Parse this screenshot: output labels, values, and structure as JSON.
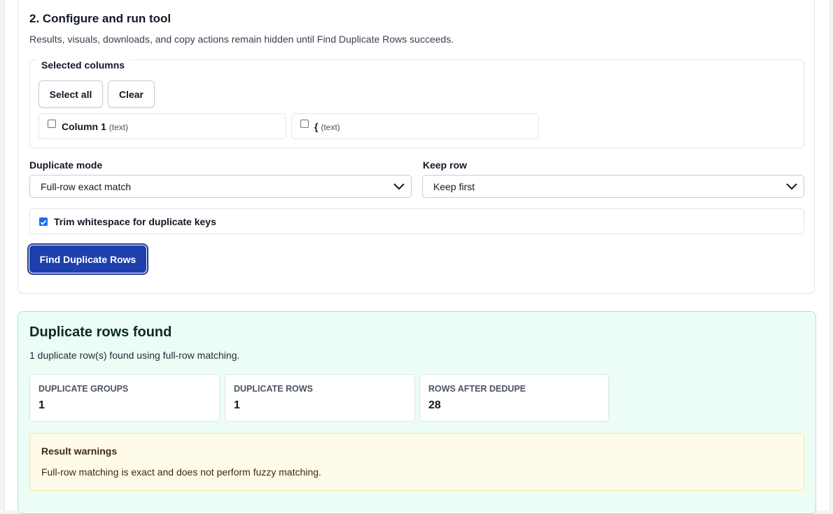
{
  "config": {
    "title": "2. Configure and run tool",
    "description": "Results, visuals, downloads, and copy actions remain hidden until Find Duplicate Rows succeeds.",
    "selected_columns": {
      "legend": "Selected columns",
      "select_all_label": "Select all",
      "clear_label": "Clear",
      "columns": [
        {
          "name": "Column 1",
          "type": "(text)",
          "checked": false
        },
        {
          "name": "{",
          "type": "(text)",
          "checked": false
        }
      ]
    },
    "duplicate_mode": {
      "label": "Duplicate mode",
      "value": "Full-row exact match"
    },
    "keep_row": {
      "label": "Keep row",
      "value": "Keep first"
    },
    "trim_whitespace": {
      "label": "Trim whitespace for duplicate keys",
      "checked": true
    },
    "find_button_label": "Find Duplicate Rows"
  },
  "result": {
    "title": "Duplicate rows found",
    "description": "1 duplicate row(s) found using full-row matching.",
    "stats": [
      {
        "label": "DUPLICATE GROUPS",
        "value": "1"
      },
      {
        "label": "DUPLICATE ROWS",
        "value": "1"
      },
      {
        "label": "ROWS AFTER DEDUPE",
        "value": "28"
      }
    ],
    "warnings": {
      "title": "Result warnings",
      "message": "Full-row matching is exact and does not perform fuzzy matching."
    }
  },
  "colors": {
    "primary_button": "#1e40af",
    "success_bg": "#ecfdf5",
    "warning_bg": "#fefce8",
    "checkbox_accent": "#1d6ee8"
  },
  "icons": {
    "select_chevron": "chevron-down-icon",
    "checkmark": "checkmark-icon"
  }
}
